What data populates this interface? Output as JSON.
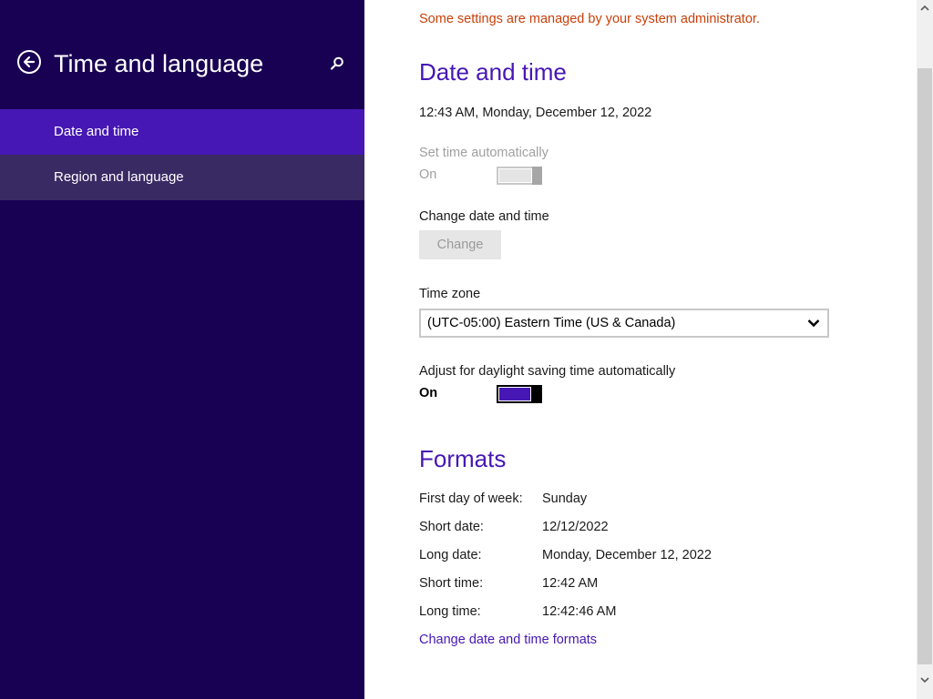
{
  "nav": {
    "title": "Time and language",
    "items": [
      {
        "label": "Date and time"
      },
      {
        "label": "Region and language"
      }
    ]
  },
  "content": {
    "admin_note": "Some settings are managed by your system administrator.",
    "date_time": {
      "heading": "Date and time",
      "current": "12:43 AM, Monday, December 12, 2022",
      "set_auto_label": "Set time automatically",
      "set_auto_state": "On",
      "set_auto_on": true,
      "change_label": "Change date and time",
      "change_button": "Change",
      "timezone_label": "Time zone",
      "timezone_value": "(UTC-05:00) Eastern Time (US & Canada)",
      "dst_label": "Adjust for daylight saving time automatically",
      "dst_state": "On",
      "dst_on": true
    },
    "formats": {
      "heading": "Formats",
      "rows": [
        {
          "key": "First day of week:",
          "value": "Sunday"
        },
        {
          "key": "Short date:",
          "value": "12/12/2022"
        },
        {
          "key": "Long date:",
          "value": "Monday, December 12, 2022"
        },
        {
          "key": "Short time:",
          "value": "12:42 AM"
        },
        {
          "key": "Long time:",
          "value": "12:42:46 AM"
        }
      ],
      "change_link": "Change date and time formats"
    }
  },
  "colors": {
    "nav_bg": "#180052",
    "accent": "#4617b4",
    "selected_item": "#4617b4",
    "warning_text": "#c8400a"
  },
  "icons": {
    "back": "back-arrow-circle-icon",
    "search": "search-icon",
    "chevron": "chevron-down-icon"
  }
}
